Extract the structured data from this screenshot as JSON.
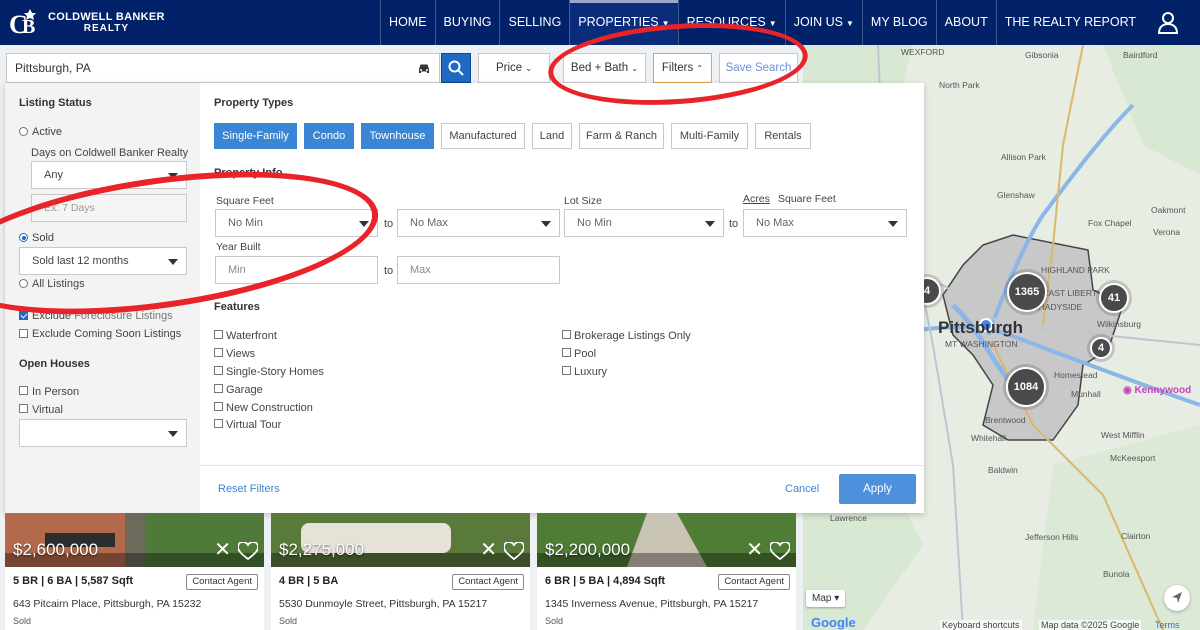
{
  "brand": {
    "line1": "COLDWELL BANKER",
    "line2": "REALTY",
    "navy": "#012169"
  },
  "nav": {
    "items": [
      {
        "label": "HOME"
      },
      {
        "label": "BUYING"
      },
      {
        "label": "SELLING"
      },
      {
        "label": "PROPERTIES",
        "dropdown": true,
        "active": true
      },
      {
        "label": "RESOURCES",
        "dropdown": true
      },
      {
        "label": "JOIN US",
        "dropdown": true
      },
      {
        "label": "MY BLOG"
      },
      {
        "label": "ABOUT"
      },
      {
        "label": "THE REALTY REPORT"
      }
    ],
    "user_icon": "user-icon"
  },
  "search": {
    "value": "Pittsburgh, PA",
    "button_icon": "search-icon",
    "commute_icon": "car-icon"
  },
  "toolbar": {
    "price": "Price",
    "bed_bath": "Bed + Bath",
    "filters": "Filters",
    "save": "Save Search"
  },
  "sidebar": {
    "listing_status": "Listing Status",
    "active": "Active",
    "days_label": "Days on Coldwell Banker Realty",
    "days_value": "Any",
    "days_placeholder": "Ex: 7 Days",
    "sold": "Sold",
    "sold_value": "Sold last 12 months",
    "all_listings": "All Listings",
    "exclude_label": "Exclude ",
    "exclude_hidden": "Foreclosure Listings",
    "exclude_coming": "Exclude Coming Soon Listings",
    "open_houses": "Open Houses",
    "in_person": "In Person",
    "virtual": "Virtual",
    "open_value": ""
  },
  "filters": {
    "property_types": "Property Types",
    "types": [
      {
        "label": "Single-Family",
        "on": true
      },
      {
        "label": "Condo",
        "on": true
      },
      {
        "label": "Townhouse",
        "on": true
      },
      {
        "label": "Manufactured",
        "on": false
      },
      {
        "label": "Land",
        "on": false
      },
      {
        "label": "Farm & Ranch",
        "on": false
      },
      {
        "label": "Multi-Family",
        "on": false
      },
      {
        "label": "Rentals",
        "on": false
      }
    ],
    "property_info": "Property Info",
    "square_feet": "Square Feet",
    "lot_size": "Lot Size",
    "acres": "Acres",
    "square_feet_unit": "Square Feet",
    "no_min": "No Min",
    "no_max": "No Max",
    "to": "to",
    "year_built": "Year Built",
    "min": "Min",
    "max": "Max",
    "features": "Features",
    "features_left": [
      "Waterfront",
      "Views",
      "Single-Story Homes",
      "Garage",
      "New Construction",
      "Virtual Tour"
    ],
    "features_right": [
      "Brokerage Listings Only",
      "Pool",
      "Luxury"
    ],
    "reset": "Reset Filters",
    "cancel": "Cancel",
    "apply": "Apply"
  },
  "map": {
    "city": "Pittsburgh",
    "labels": [
      "WEXFORD",
      "Gibsonia",
      "Bairdford",
      "North Park",
      "Allison Park",
      "Glenshaw",
      "Fox Chapel",
      "Oakmont",
      "Verona",
      "HIGHLAND PARK",
      "EAST LIBERTY",
      "SHADYSIDE",
      "Wilkinsburg",
      "MT WASHINGTON",
      "Homestead",
      "Munhall",
      "Brentwood",
      "Whitehall",
      "West Mifflin",
      "McKeesport",
      "Baldwin",
      "Jefferson Hills",
      "Clairton",
      "Lawrence",
      "Bunola",
      "Kennywood"
    ],
    "clusters": [
      "1365",
      "41",
      "4",
      "1084",
      "4"
    ],
    "map_type": "Map",
    "footer": [
      "Keyboard shortcuts",
      "Map data ©2025 Google",
      "Terms"
    ],
    "google": "Google"
  },
  "listings": [
    {
      "price": "$2,600,000",
      "specs": "5 BR | 6 BA | 5,587 Sqft",
      "address": "643 Pitcairn Place, Pittsburgh, PA 15232",
      "status": "Sold",
      "contact": "Contact Agent"
    },
    {
      "price": "$2,275,000",
      "specs": "4 BR | 5 BA",
      "address": "5530 Dunmoyle Street, Pittsburgh, PA 15217",
      "status": "Sold",
      "contact": "Contact Agent"
    },
    {
      "price": "$2,200,000",
      "specs": "6 BR | 5 BA | 4,894 Sqft",
      "address": "1345 Inverness Avenue, Pittsburgh, PA 15217",
      "status": "Sold",
      "contact": "Contact Agent"
    }
  ]
}
